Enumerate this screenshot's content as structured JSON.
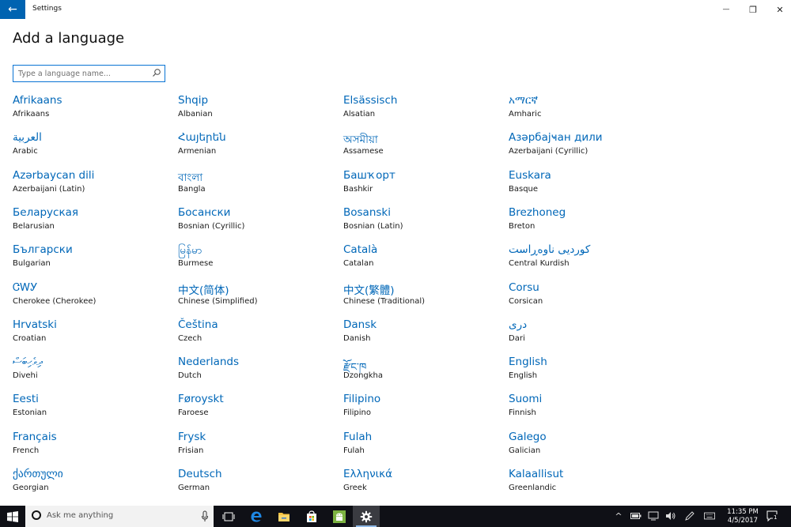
{
  "window": {
    "back_glyph": "←",
    "title": "Settings",
    "minimize_glyph": "—",
    "restore_glyph": "❐",
    "close_glyph": "✕"
  },
  "page": {
    "title": "Add a language"
  },
  "search": {
    "placeholder": "Type a language name...",
    "value": ""
  },
  "languages": [
    {
      "native": "Afrikaans",
      "english": "Afrikaans"
    },
    {
      "native": "Shqip",
      "english": "Albanian"
    },
    {
      "native": "Elsässisch",
      "english": "Alsatian"
    },
    {
      "native": "አማርኛ",
      "english": "Amharic"
    },
    {
      "native": "العربية",
      "english": "Arabic"
    },
    {
      "native": "Հայերեն",
      "english": "Armenian"
    },
    {
      "native": "অসমীয়া",
      "english": "Assamese"
    },
    {
      "native": "Азәрбајҹан дили",
      "english": "Azerbaijani (Cyrillic)"
    },
    {
      "native": "Azərbaycan dili",
      "english": "Azerbaijani (Latin)"
    },
    {
      "native": "বাংলা",
      "english": "Bangla"
    },
    {
      "native": "Башҡорт",
      "english": "Bashkir"
    },
    {
      "native": "Euskara",
      "english": "Basque"
    },
    {
      "native": "Беларуская",
      "english": "Belarusian"
    },
    {
      "native": "Босански",
      "english": "Bosnian (Cyrillic)"
    },
    {
      "native": "Bosanski",
      "english": "Bosnian (Latin)"
    },
    {
      "native": "Brezhoneg",
      "english": "Breton"
    },
    {
      "native": "Български",
      "english": "Bulgarian"
    },
    {
      "native": "မြန်မာ",
      "english": "Burmese"
    },
    {
      "native": "Català",
      "english": "Catalan"
    },
    {
      "native": "کوردیی ناوەڕاست",
      "english": "Central Kurdish"
    },
    {
      "native": "ᏣᎳᎩ",
      "english": "Cherokee (Cherokee)"
    },
    {
      "native": "中文(简体)",
      "english": "Chinese (Simplified)"
    },
    {
      "native": "中文(繁體)",
      "english": "Chinese (Traditional)"
    },
    {
      "native": "Corsu",
      "english": "Corsican"
    },
    {
      "native": "Hrvatski",
      "english": "Croatian"
    },
    {
      "native": "Čeština",
      "english": "Czech"
    },
    {
      "native": "Dansk",
      "english": "Danish"
    },
    {
      "native": "دری",
      "english": "Dari"
    },
    {
      "native": "ދިވެހިބަސް",
      "english": "Divehi"
    },
    {
      "native": "Nederlands",
      "english": "Dutch"
    },
    {
      "native": "རྫོང་ཁ",
      "english": "Dzongkha"
    },
    {
      "native": "English",
      "english": "English"
    },
    {
      "native": "Eesti",
      "english": "Estonian"
    },
    {
      "native": "Føroyskt",
      "english": "Faroese"
    },
    {
      "native": "Filipino",
      "english": "Filipino"
    },
    {
      "native": "Suomi",
      "english": "Finnish"
    },
    {
      "native": "Français",
      "english": "French"
    },
    {
      "native": "Frysk",
      "english": "Frisian"
    },
    {
      "native": "Fulah",
      "english": "Fulah"
    },
    {
      "native": "Galego",
      "english": "Galician"
    },
    {
      "native": "ქართული",
      "english": "Georgian"
    },
    {
      "native": "Deutsch",
      "english": "German"
    },
    {
      "native": "Ελληνικά",
      "english": "Greek"
    },
    {
      "native": "Kalaallisut",
      "english": "Greenlandic"
    }
  ],
  "taskbar": {
    "cortana_placeholder": "Ask me anything",
    "start_icon": "windows-logo-icon",
    "apps": [
      "task-view-icon",
      "edge-icon",
      "file-explorer-icon",
      "store-icon",
      "android-icon",
      "settings-icon"
    ],
    "active_app": "settings-icon",
    "time": "11:35 PM",
    "date": "4/5/2017",
    "notification_count": "1"
  }
}
